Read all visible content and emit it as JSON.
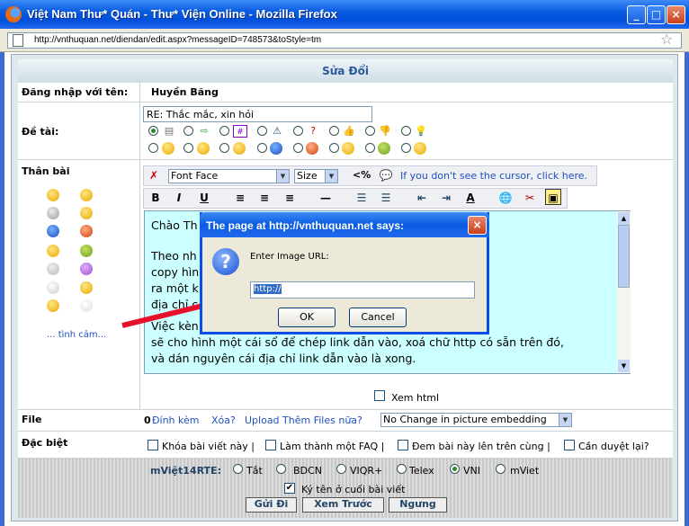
{
  "window": {
    "title": "Việt Nam Thư* Quán - Thư* Viện Online - Mozilla Firefox",
    "url": "http://vnthuquan.net/diendan/edit.aspx?messageID=748573&toStyle=tm"
  },
  "form": {
    "header": "Sửa Đổi",
    "login_label": "Đăng nhập với tên:",
    "login_value": "Huyền Băng",
    "subject_label": "Đề tài:",
    "subject_value": "RE: Thắc mắc, xin hỏi",
    "body_label": "Thân bài",
    "more_emotions": "... tình cảm...",
    "font_face": "Font Face",
    "font_size": "Size",
    "cursor_hint": "If you don't see the cursor, click here.",
    "editor_lines": [
      "Chào Th",
      "Theo nh                                                        ý địa chỉ link TG",
      "copy hìn                                                      xem sao nhé, ví dư",
      "ra một k                                                      Kíu không dẫn đến",
      "địa chỉ c",
      "Việc kèn                                                     ó hình trăng, núi nó",
      "sẽ cho hình một cái sổ để chép link dẫn vào, xoá chữ http có sẵn trên đó,",
      "và dán nguyên cái địa chỉ link dẫn vào là xong."
    ],
    "xem_html": "Xem html",
    "file_label": "File",
    "attach": "Đính kèm",
    "delete": "Xóa?",
    "upload": "Upload Thêm Files nữa?",
    "picture_embedding": "No Change in picture embedding",
    "special_label": "Đặc biệt",
    "special_options": [
      "Khóa bài viết này |",
      "Làm thành một FAQ |",
      "Đem bài này lên trên cùng |",
      "Cần duyệt lại?"
    ],
    "rte_label": "mViệt14RTE:",
    "rte_options": [
      "Tắt",
      "BDCN",
      "VIQR+",
      "Telex",
      "VNI",
      "mViet"
    ],
    "rte_selected": "VNI",
    "signature": "Ký tên ở cuối bài viết",
    "buttons": {
      "send": "Gửi Đi",
      "preview": "Xem Trước",
      "stop": "Ngưng"
    }
  },
  "dialog": {
    "title": "The page at http://vnthuquan.net says:",
    "message": "Enter Image URL:",
    "input_value": "http://",
    "ok": "OK",
    "cancel": "Cancel"
  },
  "colors": {
    "titlebar": "#0a5ce0",
    "editor_bg": "#ccffff",
    "arrow": "#e8102a"
  }
}
